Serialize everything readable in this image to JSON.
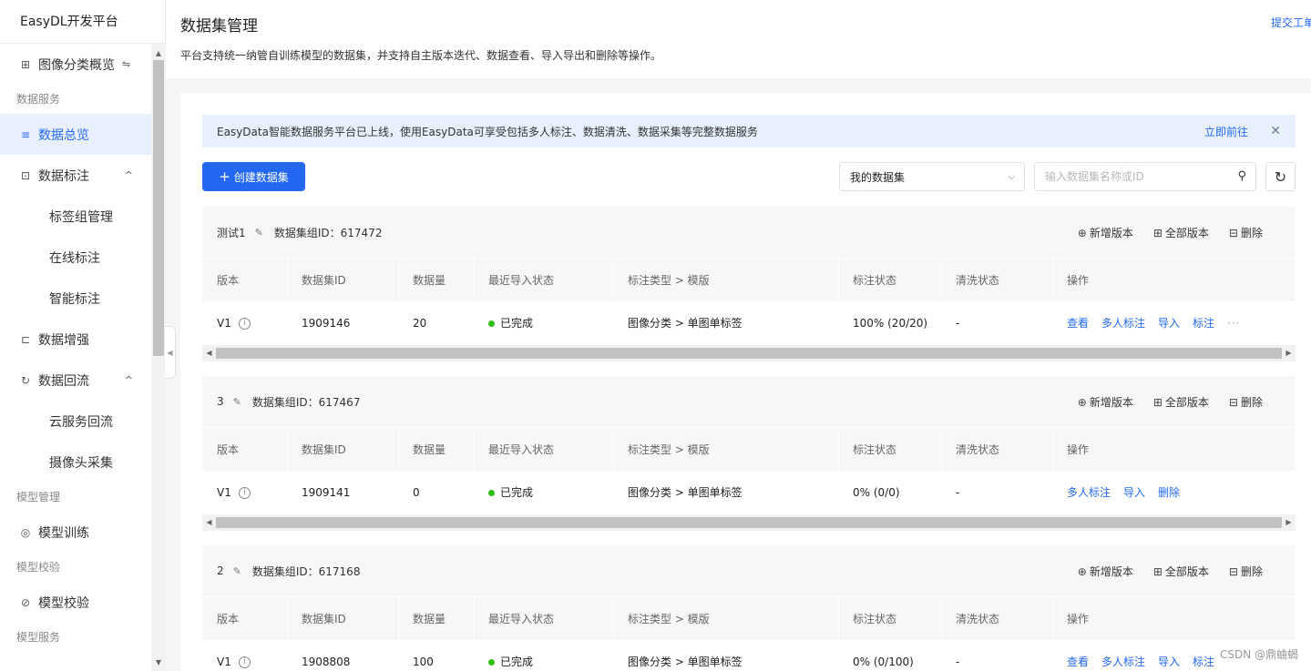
{
  "sidebar": {
    "brand": "EasyDL开发平台",
    "items": [
      {
        "type": "item",
        "icon": "grid-icon",
        "glyph": "⊞",
        "label": "图像分类概览",
        "swap": "⇋"
      },
      {
        "type": "group",
        "label": "数据服务"
      },
      {
        "type": "item",
        "icon": "database-icon",
        "glyph": "≡",
        "label": "数据总览",
        "active": true
      },
      {
        "type": "item",
        "icon": "label-scan-icon",
        "glyph": "⊡",
        "label": "数据标注",
        "caret": "^"
      },
      {
        "type": "sub",
        "label": "标签组管理"
      },
      {
        "type": "sub",
        "label": "在线标注"
      },
      {
        "type": "sub",
        "label": "智能标注"
      },
      {
        "type": "item",
        "icon": "augment-icon",
        "glyph": "⊏",
        "label": "数据增强"
      },
      {
        "type": "item",
        "icon": "refresh-flow-icon",
        "glyph": "↻",
        "label": "数据回流",
        "caret": "^"
      },
      {
        "type": "sub",
        "label": "云服务回流"
      },
      {
        "type": "sub",
        "label": "摄像头采集"
      },
      {
        "type": "group",
        "label": "模型管理"
      },
      {
        "type": "item",
        "icon": "target-icon",
        "glyph": "◎",
        "label": "模型训练"
      },
      {
        "type": "group",
        "label": "模型校验"
      },
      {
        "type": "item",
        "icon": "check-circle-icon",
        "glyph": "⊘",
        "label": "模型校验"
      },
      {
        "type": "group",
        "label": "模型服务"
      }
    ]
  },
  "header": {
    "title": "数据集管理",
    "description": "平台支持统一纳管自训练模型的数据集，并支持自主版本迭代、数据查看、导入导出和删除等操作。",
    "submit_ticket": "提交工单"
  },
  "notice": {
    "text": "EasyData智能数据服务平台已上线，使用EasyData可享受包括多人标注、数据清洗、数据采集等完整数据服务",
    "link": "立即前往",
    "close": "✕"
  },
  "toolbar": {
    "create_label": "创建数据集",
    "filter_value": "我的数据集",
    "search_placeholder": "输入数据集名称或ID"
  },
  "columns": [
    "版本",
    "数据集ID",
    "数据量",
    "最近导入状态",
    "标注类型 > 模版",
    "标注状态",
    "清洗状态",
    "操作"
  ],
  "group_actions": {
    "add_version": "新增版本",
    "all_versions": "全部版本",
    "delete": "删除"
  },
  "datasets": [
    {
      "name": "测试1",
      "group_id_label": "数据集组ID：617472",
      "row": {
        "version": "V1",
        "dataset_id": "1909146",
        "count": "20",
        "import_status": "已完成",
        "annotation_type": "图像分类 > 单图单标签",
        "annotation_status": "100% (20/20)",
        "clean_status": "-",
        "ops": [
          "查看",
          "多人标注",
          "导入",
          "标注",
          "···"
        ]
      }
    },
    {
      "name": "3",
      "group_id_label": "数据集组ID：617467",
      "row": {
        "version": "V1",
        "dataset_id": "1909141",
        "count": "0",
        "import_status": "已完成",
        "annotation_type": "图像分类 > 单图单标签",
        "annotation_status": "0% (0/0)",
        "clean_status": "-",
        "ops": [
          "多人标注",
          "导入",
          "删除"
        ]
      }
    },
    {
      "name": "2",
      "group_id_label": "数据集组ID：617168",
      "row": {
        "version": "V1",
        "dataset_id": "1908808",
        "count": "100",
        "import_status": "已完成",
        "annotation_type": "图像分类 > 单图单标签",
        "annotation_status": "0% (0/100)",
        "clean_status": "-",
        "ops": [
          "查看",
          "多人标注",
          "导入",
          "标注"
        ]
      }
    }
  ],
  "watermark": "CSDN @鼎蛐蝎",
  "colors": {
    "accent": "#2468f2",
    "success": "#30bf13",
    "notice_bg": "#e8f0fe"
  }
}
